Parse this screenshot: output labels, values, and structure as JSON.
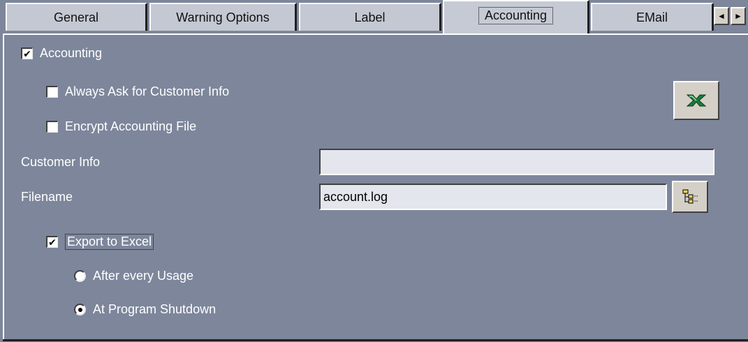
{
  "tabs": [
    {
      "label": "General"
    },
    {
      "label": "Warning Options"
    },
    {
      "label": "Label"
    },
    {
      "label": "Accounting",
      "active": true
    },
    {
      "label": "EMail"
    }
  ],
  "tab_scroll": {
    "left_glyph": "◄",
    "right_glyph": "►"
  },
  "accounting": {
    "enable_label": "Accounting",
    "enable_checked": true,
    "always_ask_label": "Always Ask for Customer Info",
    "always_ask_checked": false,
    "encrypt_label": "Encrypt Accounting File",
    "encrypt_checked": false,
    "customer_info_label": "Customer Info",
    "customer_info_value": "",
    "filename_label": "Filename",
    "filename_value": "account.log",
    "export_label": "Export to Excel",
    "export_checked": true,
    "radio_after_label": "After every Usage",
    "radio_shutdown_label": "At Program Shutdown",
    "radio_selected": "At Program Shutdown",
    "check_glyph": "✔"
  },
  "icons": {
    "excel": "excel-icon",
    "browse": "folder-tree-icon"
  },
  "colors": {
    "background": "#7d869b",
    "tab_face": "#c4c8d2",
    "field_bg": "#e3e6ec",
    "excel_green": "#1a7a3a"
  }
}
